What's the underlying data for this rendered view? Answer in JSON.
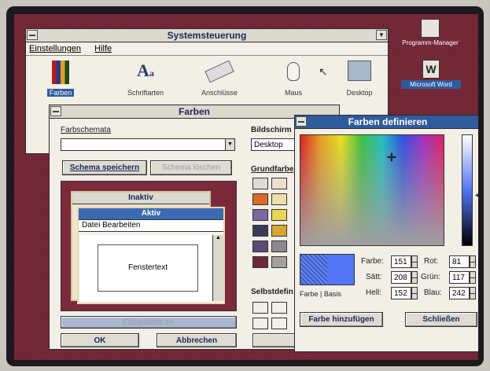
{
  "desktop": {
    "program_manager": "Programm-Manager",
    "winword": "Microsoft Word"
  },
  "control_panel": {
    "title": "Systemsteuerung",
    "menu": [
      "Einstellungen",
      "Hilfe"
    ],
    "icons": [
      {
        "label": "Farben",
        "icon": "color-pencils-icon"
      },
      {
        "label": "Schriftarten",
        "icon": "fonts-icon"
      },
      {
        "label": "Anschlüsse",
        "icon": "ports-icon"
      },
      {
        "label": "Maus",
        "icon": "mouse-icon"
      },
      {
        "label": "Desktop",
        "icon": "desktop-icon"
      }
    ]
  },
  "farben": {
    "title": "Farben",
    "schemes_label": "Farbschemata",
    "scheme_value": "",
    "save_scheme": "Schema speichern",
    "delete_scheme": "Schema löschen",
    "preview": {
      "inactive": "Inaktiv",
      "active": "Aktiv",
      "menu": "Datei  Bearbeiten",
      "window_text": "Fenstertext"
    },
    "palette_button": "Farbpalette >>",
    "ok": "OK",
    "cancel": "Abbrechen",
    "screen_element_label": "Bildschirm",
    "screen_element_value": "Desktop",
    "basic_colors_label": "Grundfarbe",
    "custom_colors_label": "Selbstdefin",
    "basic_colors": [
      "#e0dcd4",
      "#e8e0cc",
      "#d96a2a",
      "#eedfa8",
      "#7a6aa0",
      "#e6d850",
      "#3a3a58",
      "#d6a830",
      "#5a4a78",
      "#8a8a90",
      "#6a2a3a",
      "#a8a098"
    ]
  },
  "define": {
    "title": "Farben definieren",
    "color_solid_label": "Farbe | Basis",
    "hue_label": "Farbe:",
    "sat_label": "Sätt:",
    "lum_label": "Hell:",
    "red_label": "Rot:",
    "green_label": "Grün:",
    "blue_label": "Blau:",
    "hue": "151",
    "sat": "208",
    "lum": "152",
    "red": "81",
    "green": "117",
    "blue": "242",
    "add_color": "Farbe hinzufügen",
    "close": "Schließen",
    "preview_color": "#5175f2"
  }
}
